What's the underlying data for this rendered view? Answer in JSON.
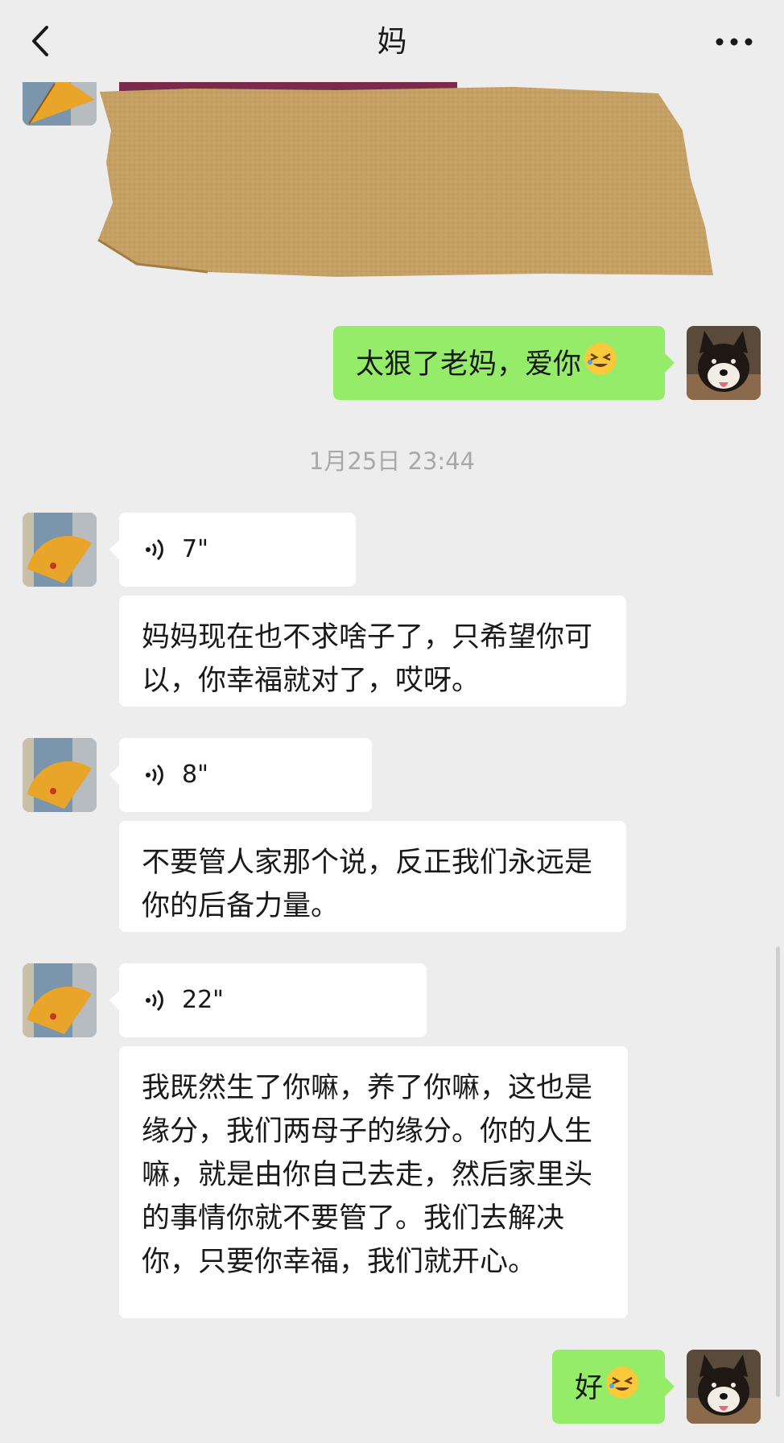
{
  "header": {
    "title": "妈",
    "back_icon": "chevron-left-icon",
    "more_icon": "more-dots-icon"
  },
  "messages": {
    "m1_out": "太狠了老妈，爱你",
    "timestamp": "1月25日 23:44",
    "v1_duration": "7\"",
    "v1_text": "妈妈现在也不求啥子了，只希望你可以，你幸福就对了，哎呀。",
    "v2_duration": "8\"",
    "v2_text": "不要管人家那个说，反正我们永远是你的后备力量。",
    "v3_duration": "22\"",
    "v3_text": "我既然生了你嘛，养了你嘛，这也是缘分，我们两母子的缘分。你的人生嘛，就是由你自己去走，然后家里头的事情你就不要管了。我们去解决你，只要你幸福，我们就开心。",
    "m2_out": "好"
  },
  "colors": {
    "background": "#ededed",
    "outgoing_bubble": "#95ec69",
    "incoming_bubble": "#ffffff",
    "timestamp_text": "#a8a8a8"
  }
}
